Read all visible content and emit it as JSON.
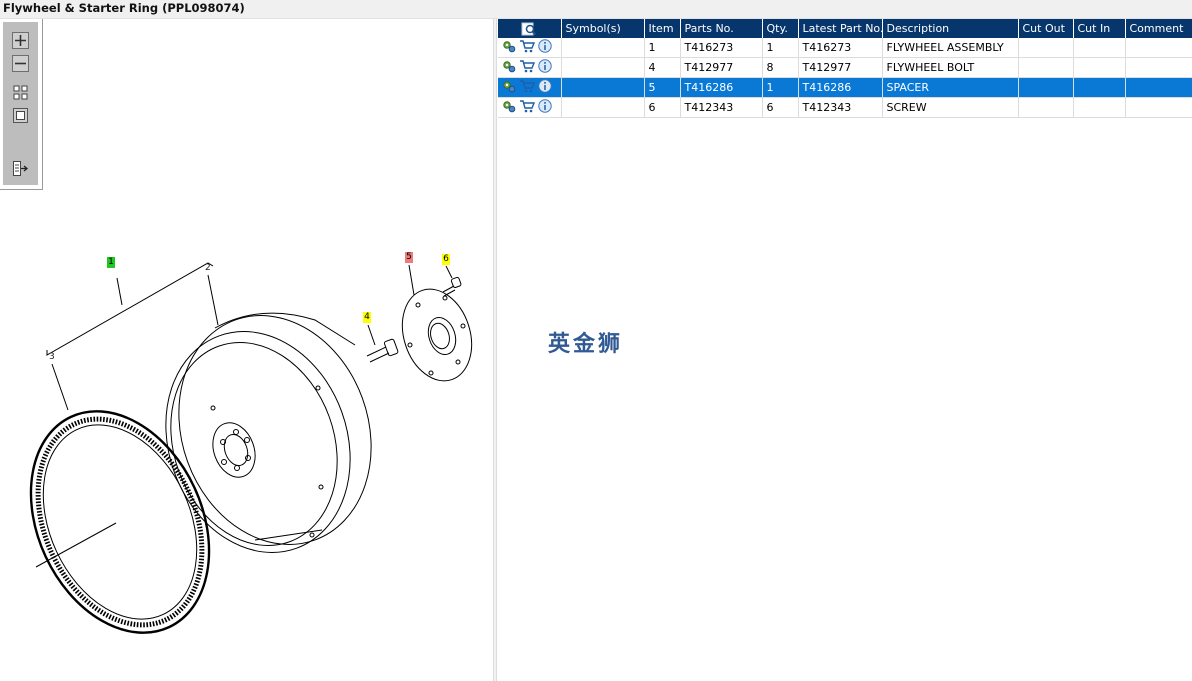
{
  "window": {
    "title": "Flywheel & Starter Ring (PPL098074)"
  },
  "toolbox": {
    "tools": [
      "zoom-in-icon",
      "zoom-out-icon",
      "fit-all-icon",
      "actual-size-icon",
      "export-list-icon"
    ]
  },
  "diagram": {
    "callouts": [
      {
        "label": "1",
        "highlight": "#1ec81e"
      },
      {
        "label": "2",
        "highlight": ""
      },
      {
        "label": "3",
        "highlight": ""
      },
      {
        "label": "4",
        "highlight": "#ffff00"
      },
      {
        "label": "5",
        "highlight": "#ee7b7b"
      },
      {
        "label": "6",
        "highlight": "#ffff00"
      }
    ]
  },
  "grid": {
    "columns": [
      "",
      "Symbol(s)",
      "Item",
      "Parts No.",
      "Qty.",
      "Latest Part No.",
      "Description",
      "Cut Out",
      "Cut In",
      "Comment"
    ],
    "rows": [
      {
        "item": "1",
        "parts_no": "T416273",
        "qty": "1",
        "latest": "T416273",
        "description": "FLYWHEEL ASSEMBLY",
        "cut_out": "",
        "cut_in": "",
        "comment": ""
      },
      {
        "item": "4",
        "parts_no": "T412977",
        "qty": "8",
        "latest": "T412977",
        "description": "FLYWHEEL BOLT",
        "cut_out": "",
        "cut_in": "",
        "comment": ""
      },
      {
        "item": "5",
        "parts_no": "T416286",
        "qty": "1",
        "latest": "T416286",
        "description": "SPACER",
        "cut_out": "",
        "cut_in": "",
        "comment": ""
      },
      {
        "item": "6",
        "parts_no": "T412343",
        "qty": "6",
        "latest": "T412343",
        "description": "SCREW",
        "cut_out": "",
        "cut_in": "",
        "comment": ""
      }
    ],
    "selected_row": 2,
    "row_icons": [
      "details-icon",
      "cart-icon",
      "info-icon"
    ]
  },
  "watermark": "英金狮",
  "colors": {
    "header": "#07366c",
    "selected": "#0a79d6"
  }
}
